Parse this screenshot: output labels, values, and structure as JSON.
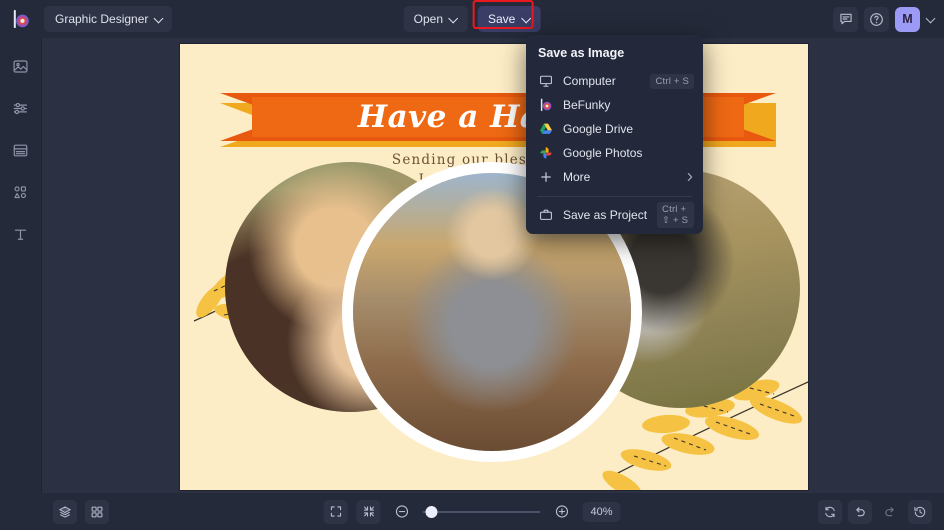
{
  "app": {
    "brand_icon": "befunky-logo-icon",
    "accent_purple": "#9b9bf5",
    "highlight_red": "#e8191f",
    "topbar_bg": "#252a3a"
  },
  "topbar": {
    "document_selector": {
      "label": "Graphic Designer",
      "icon": "chevron-down-icon"
    },
    "open_button": {
      "label": "Open",
      "icon": "chevron-down-icon"
    },
    "save_button": {
      "label": "Save",
      "icon": "chevron-down-icon",
      "highlighted": true
    },
    "feedback_icon": "comment-icon",
    "help_icon": "help-circle-icon",
    "avatar": {
      "initial": "M",
      "icon": "chevron-down-icon"
    }
  },
  "sidebar": {
    "items": [
      {
        "name": "image",
        "icon": "image-icon"
      },
      {
        "name": "edit",
        "icon": "sliders-icon"
      },
      {
        "name": "templates",
        "icon": "layout-icon"
      },
      {
        "name": "graphics",
        "icon": "shapes-icon"
      },
      {
        "name": "text",
        "icon": "text-icon"
      }
    ]
  },
  "save_menu": {
    "header": "Save as Image",
    "items": [
      {
        "label": "Computer",
        "icon": "monitor-icon",
        "shortcut": "Ctrl + S"
      },
      {
        "label": "BeFunky",
        "icon": "befunky-icon",
        "shortcut": ""
      },
      {
        "label": "Google Drive",
        "icon": "google-drive-icon",
        "shortcut": ""
      },
      {
        "label": "Google Photos",
        "icon": "google-photos-icon",
        "shortcut": ""
      },
      {
        "label": "More",
        "icon": "plus-icon",
        "shortcut": "",
        "submenu": "chevron-right-icon"
      }
    ],
    "project_item": {
      "label": "Save as Project",
      "icon": "briefcase-icon",
      "shortcut": "Ctrl + ⇧ + S"
    }
  },
  "canvas": {
    "background_color": "#fdedc6",
    "banner": {
      "text": "Have a Happy T",
      "color": "#ef6914",
      "shadow_color": "#f0a81e"
    },
    "subtitle_line1": "Sending our blessings thi",
    "subtitle_line2": "Love from the Clar",
    "photos": [
      {
        "name": "photo-left",
        "alt": "mother with baby"
      },
      {
        "name": "photo-main",
        "alt": "family portrait"
      },
      {
        "name": "photo-right",
        "alt": "parent and toddler"
      }
    ],
    "decorations": [
      "leaf-branch-top-left",
      "leaf-branch-bottom-right"
    ]
  },
  "bottombar": {
    "layers_icon": "layers-icon",
    "grid_icon": "grid-icon",
    "fullscreen_icon": "expand-icon",
    "fit_icon": "collapse-icon",
    "zoom_out_icon": "minus-circle-icon",
    "zoom_in_icon": "plus-circle-icon",
    "zoom_level": "40%",
    "zoom_slider_value": 3,
    "sync_icon": "refresh-icon",
    "undo_icon": "undo-icon",
    "redo_icon": "redo-icon",
    "history_icon": "history-icon"
  }
}
